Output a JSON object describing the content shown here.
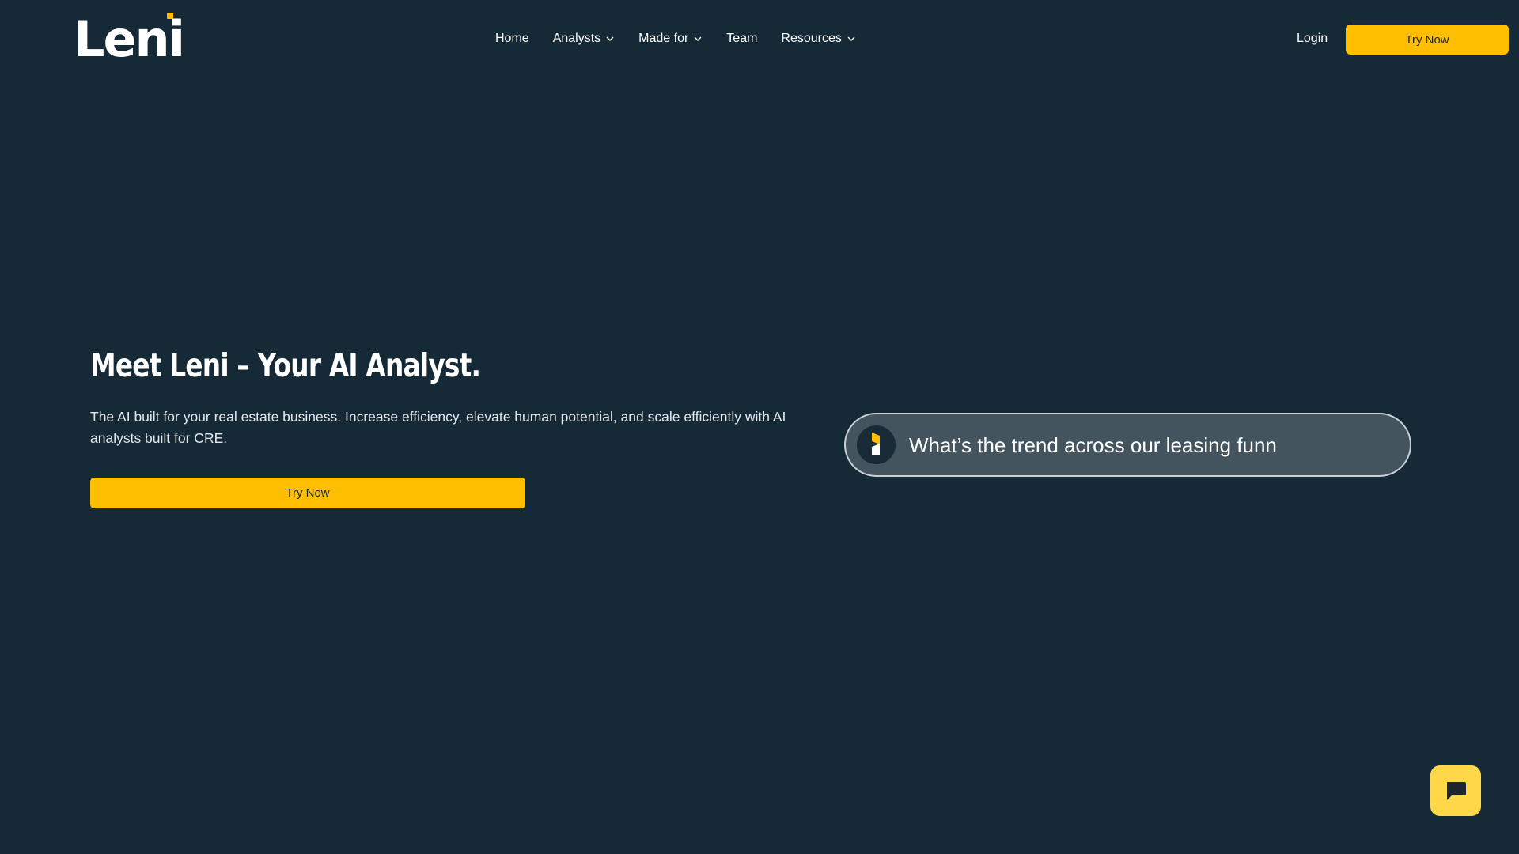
{
  "brand": {
    "name": "Leni",
    "accent_color": "#FFBE00",
    "background_color": "#152937"
  },
  "nav": {
    "items": [
      {
        "label": "Home",
        "dropdown": false
      },
      {
        "label": "Analysts",
        "dropdown": true
      },
      {
        "label": "Made for",
        "dropdown": true
      },
      {
        "label": "Team",
        "dropdown": false
      },
      {
        "label": "Resources",
        "dropdown": true
      }
    ],
    "login_label": "Login",
    "cta_label": "Try Now"
  },
  "hero": {
    "title": "Meet Leni – Your AI Analyst.",
    "subtitle": "The AI built for your real estate business. Increase efficiency, elevate human potential, and scale efficiently with AI analysts built for CRE.",
    "cta_label": "Try Now"
  },
  "prompt": {
    "text": "What’s the trend across our leasing funn",
    "avatar_icon": "leni-mark-icon"
  },
  "chat_widget": {
    "icon": "chat-bubble-icon"
  }
}
